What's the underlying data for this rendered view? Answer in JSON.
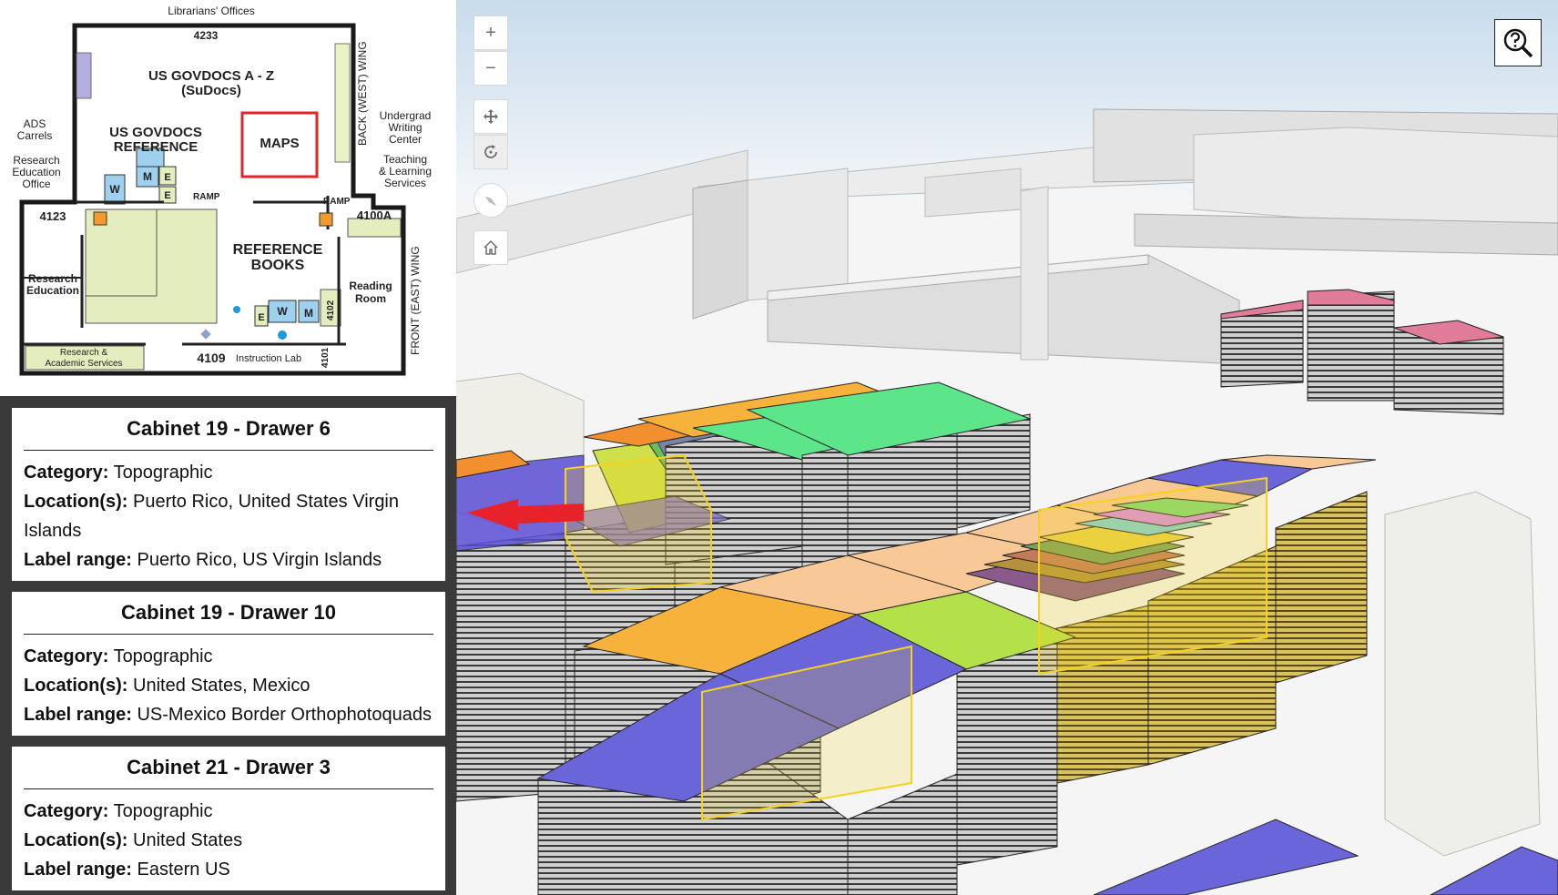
{
  "floor_plan": {
    "labels": {
      "librarians_offices": "Librarians' Offices",
      "room_4233": "4233",
      "govdocs_az_line1": "US GOVDOCS A - Z",
      "govdocs_az_line2": "(SuDocs)",
      "back_west_wing": "BACK (WEST) WING",
      "ads_carrels_line1": "ADS",
      "ads_carrels_line2": "Carrels",
      "govdocs_ref_line1": "US GOVDOCS",
      "govdocs_ref_line2": "REFERENCE",
      "maps": "MAPS",
      "undergrad_line1": "Undergrad",
      "undergrad_line2": "Writing",
      "undergrad_line3": "Center",
      "research_office_line1": "Research",
      "research_office_line2": "Education",
      "research_office_line3": "Office",
      "teaching_line1": "Teaching",
      "teaching_line2": "& Learning",
      "teaching_line3": "Services",
      "ramp": "RAMP",
      "room_4123": "4123",
      "room_4100a": "4100A",
      "reference_books_line1": "REFERENCE",
      "reference_books_line2": "BOOKS",
      "front_east_wing": "FRONT (EAST) WING",
      "research_edu_line1": "Research",
      "research_edu_line2": "Education",
      "reading_room_line1": "Reading",
      "reading_room_line2": "Room",
      "room_4102": "4102",
      "research_services_line1": "Research &",
      "research_services_line2": "Academic Services",
      "room_4109": "4109",
      "instruction_lab": "Instruction Lab",
      "room_4101": "4101",
      "w": "W",
      "m": "M",
      "e": "E"
    },
    "highlight_color": "#e0262b"
  },
  "cards": [
    {
      "title": "Cabinet 19 - Drawer 6",
      "category_label": "Category:",
      "category": "Topographic",
      "location_label": "Location(s):",
      "location": "Puerto Rico, United States Virgin Islands",
      "range_label": "Label range:",
      "range": "Puerto Rico, US Virgin Islands"
    },
    {
      "title": "Cabinet 19 - Drawer 10",
      "category_label": "Category:",
      "category": "Topographic",
      "location_label": "Location(s):",
      "location": "United States, Mexico",
      "range_label": "Label range:",
      "range": "US-Mexico Border Orthophotoquads"
    },
    {
      "title": "Cabinet 21 - Drawer 3",
      "category_label": "Category:",
      "category": "Topographic",
      "location_label": "Location(s):",
      "location": "United States",
      "range_label": "Label range:",
      "range": "Eastern US"
    }
  ],
  "map_controls": {
    "zoom_in": "+",
    "zoom_out": "−",
    "pan_icon": "move-arrows-icon",
    "rotate_icon": "rotate-icon",
    "compass_icon": "compass-icon",
    "home_icon": "home-icon",
    "search_icon": "magnifier-question-icon"
  },
  "colors": {
    "purple": "#6a66d9",
    "orange": "#f7b23c",
    "green": "#5de58a",
    "peach": "#f8c896",
    "lime": "#b4e04a",
    "pink": "#e07b9a",
    "highlight": "#f5d21e",
    "arrow": "#e8222a"
  }
}
